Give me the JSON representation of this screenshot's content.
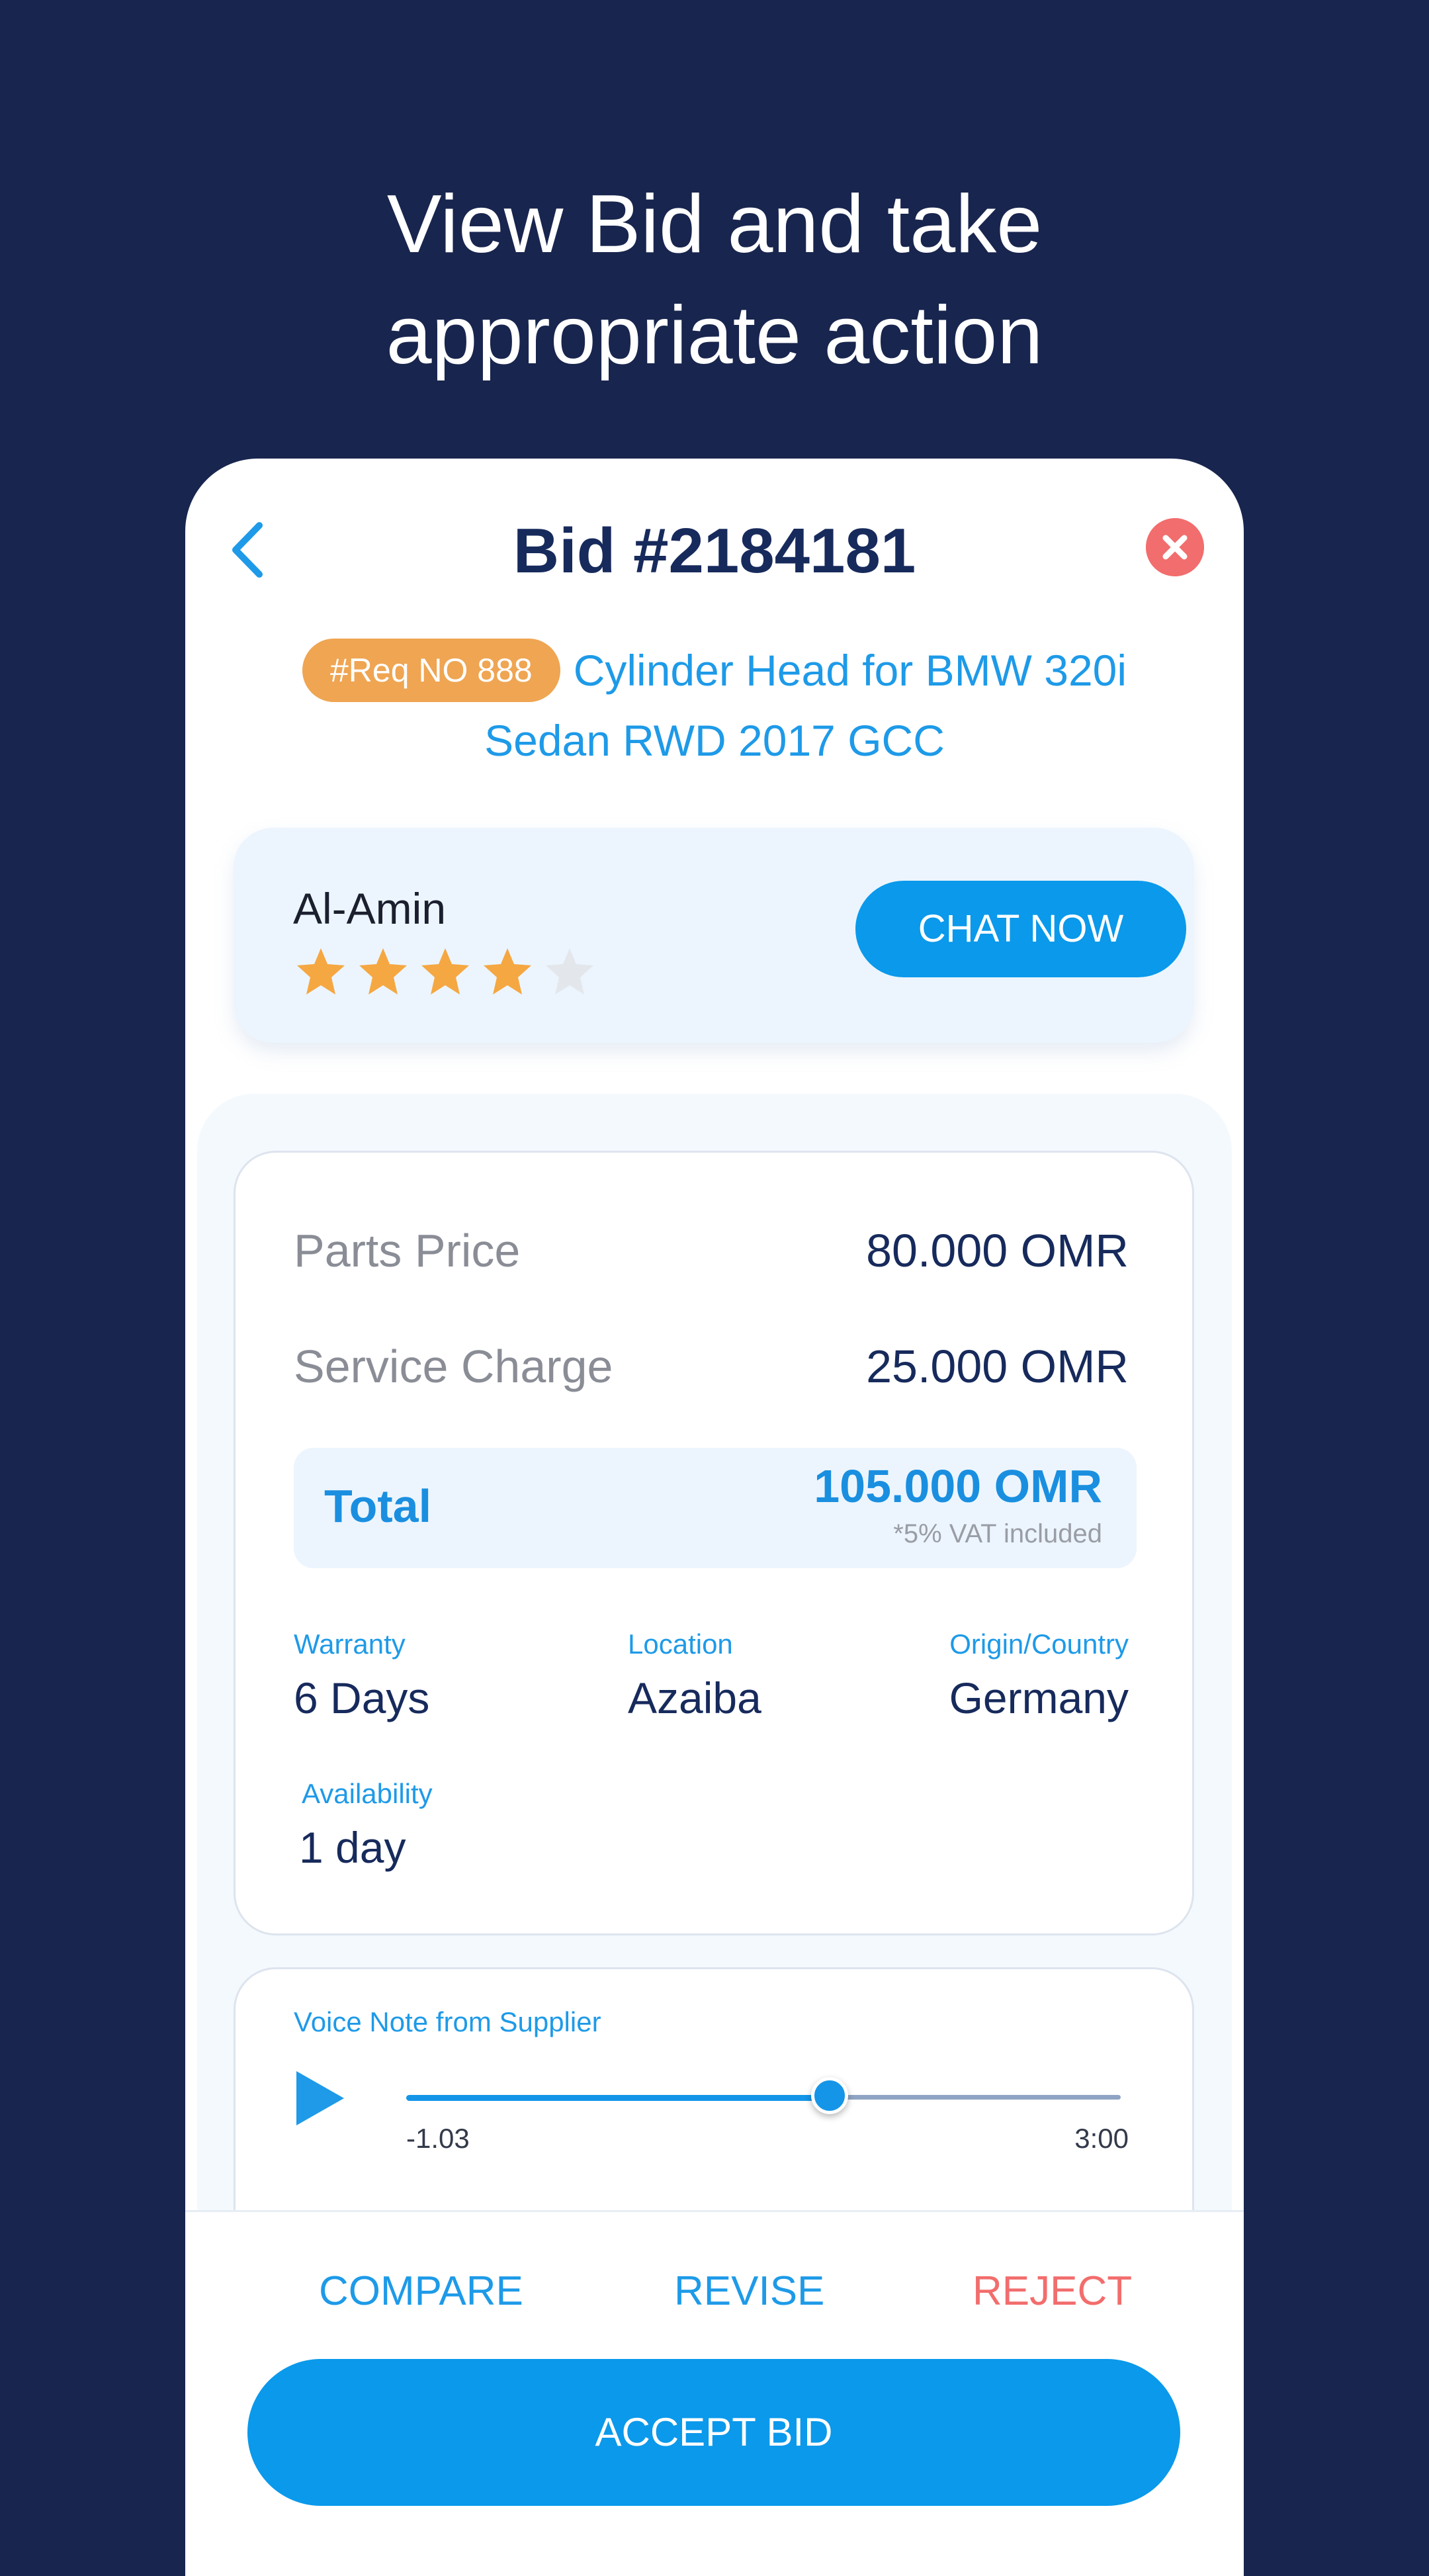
{
  "headline": {
    "line1": "View Bid and take",
    "line2": "appropriate action"
  },
  "header": {
    "title": "Bid #2184181",
    "back_icon": "chevron-left-icon",
    "close_icon": "close-icon"
  },
  "request": {
    "badge": "#Req NO 888",
    "title": "Cylinder Head for BMW 320i Sedan RWD 2017 GCC"
  },
  "seller": {
    "name": "Al-Amin",
    "rating": 4,
    "rating_max": 5,
    "chat_label": "CHAT NOW"
  },
  "pricing": {
    "parts_label": "Parts Price",
    "parts_value": "80.000 OMR",
    "service_label": "Service Charge",
    "service_value": "25.000 OMR",
    "total_label": "Total",
    "total_value": "105.000 OMR",
    "vat_note": "*5% VAT included"
  },
  "details": {
    "warranty_label": "Warranty",
    "warranty_value": "6 Days",
    "location_label": "Location",
    "location_value": "Azaiba",
    "origin_label": "Origin/Country",
    "origin_value": "Germany",
    "availability_label": "Availability",
    "availability_value": "1 day"
  },
  "voice_note": {
    "label": "Voice Note from Supplier",
    "elapsed": "-1.03",
    "duration": "3:00",
    "progress": 0.5
  },
  "actions": {
    "compare": "COMPARE",
    "revise": "REVISE",
    "reject": "REJECT",
    "accept": "ACCEPT BID"
  },
  "colors": {
    "background": "#18254e",
    "accent": "#0a99eb",
    "badge": "#efa552",
    "reject": "#f26d6d",
    "star": "#f5a742",
    "star_empty": "#e3e7ec"
  }
}
